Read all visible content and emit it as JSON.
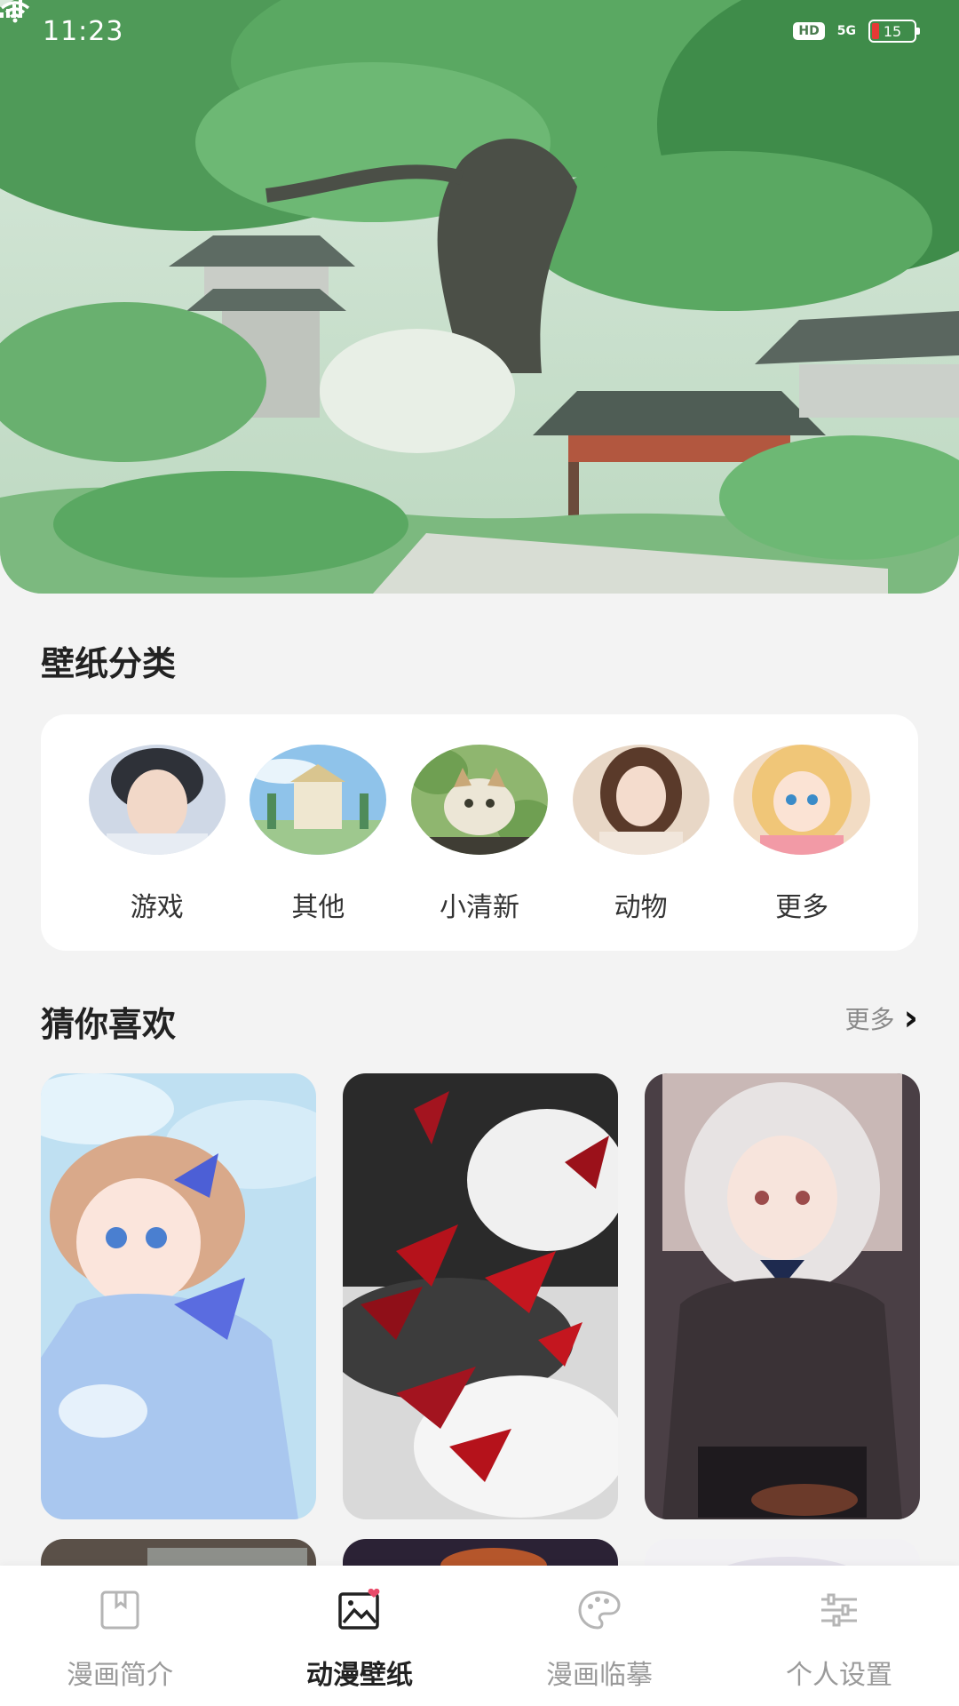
{
  "status_bar": {
    "time": "11:23",
    "hd": "HD",
    "network": "5G",
    "battery": "15"
  },
  "hero": {
    "icon": "garden-pavilion-illustration"
  },
  "categories": {
    "title": "壁纸分类",
    "items": [
      {
        "label": "游戏",
        "icon": "boy-portrait"
      },
      {
        "label": "其他",
        "icon": "palace-landscape"
      },
      {
        "label": "小清新",
        "icon": "kitten"
      },
      {
        "label": "动物",
        "icon": "girl-portrait"
      },
      {
        "label": "更多",
        "icon": "blonde-girl"
      }
    ]
  },
  "recommend": {
    "title": "猜你喜欢",
    "more_label": "更多",
    "cards": [
      {
        "name": "butterfly-girl"
      },
      {
        "name": "red-leaves"
      },
      {
        "name": "silver-hair-girl"
      },
      {
        "name": "partial-card-1"
      },
      {
        "name": "partial-card-2"
      },
      {
        "name": "partial-card-3"
      }
    ]
  },
  "bottom_nav": {
    "items": [
      {
        "label": "漫画简介",
        "icon": "bookmark-icon"
      },
      {
        "label": "动漫壁纸",
        "icon": "image-icon",
        "active": true
      },
      {
        "label": "漫画临摹",
        "icon": "palette-icon"
      },
      {
        "label": "个人设置",
        "icon": "sliders-icon"
      }
    ]
  },
  "colors": {
    "background": "#f3f3f3",
    "card": "#ffffff",
    "hero_green": "#5fa56a",
    "active_text": "#222222",
    "inactive_text": "#9a9a9a"
  }
}
